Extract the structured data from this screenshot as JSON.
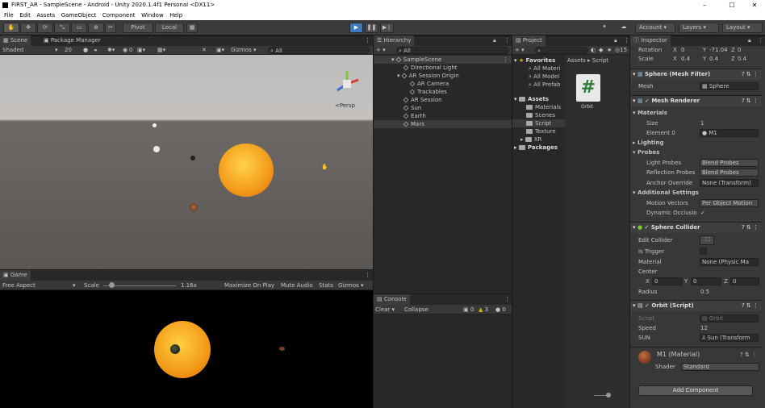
{
  "window": {
    "title": "FIRST_AR - SampleScene - Android - Unity 2020.1.4f1 Personal <DX11>",
    "min": "–",
    "max": "☐",
    "close": "✕"
  },
  "menu": [
    "File",
    "Edit",
    "Assets",
    "GameObject",
    "Component",
    "Window",
    "Help"
  ],
  "toolbar": {
    "pivot": "Pivot",
    "local": "Local",
    "account": "Account",
    "layers": "Layers",
    "layout": "Layout"
  },
  "scene": {
    "tab": "Scene",
    "tab2": "Package Manager",
    "shading": "Shaded",
    "gizmos": "Gizmos",
    "search": "All",
    "persp": "<Persp",
    "fov": "20",
    "layers_count": "0"
  },
  "game": {
    "tab": "Game",
    "aspect": "Free Aspect",
    "scale_label": "Scale",
    "scale_value": "1.16x",
    "maximize": "Maximize On Play",
    "mute": "Mute Audio",
    "stats": "Stats",
    "gizmos": "Gizmos"
  },
  "hierarchy": {
    "tab": "Hierarchy",
    "search": "All",
    "items": [
      {
        "label": "SampleScene",
        "depth": 0
      },
      {
        "label": "Directional Light",
        "depth": 1
      },
      {
        "label": "AR Session Origin",
        "depth": 1
      },
      {
        "label": "AR Camera",
        "depth": 2
      },
      {
        "label": "Trackables",
        "depth": 2
      },
      {
        "label": "AR Session",
        "depth": 1
      },
      {
        "label": "Sun",
        "depth": 1
      },
      {
        "label": "Earth",
        "depth": 1
      },
      {
        "label": "Mars",
        "depth": 1
      }
    ]
  },
  "console": {
    "tab": "Console",
    "clear": "Clear",
    "collapse": "Collapse",
    "logs": "0",
    "warnings": "3",
    "errors": "0"
  },
  "project": {
    "tab": "Project",
    "hidden_count": "15",
    "favorites": "Favorites",
    "fav_items": [
      "All Materi",
      "All Model",
      "All Prefab"
    ],
    "assets": "Assets",
    "asset_items": [
      "Materials",
      "Scenes",
      "Script",
      "Texture",
      "XR"
    ],
    "packages": "Packages",
    "breadcrumb": [
      "Assets",
      "Script"
    ],
    "file": "Orbit"
  },
  "inspector": {
    "tab": "Inspector",
    "rotation": {
      "label": "Rotation",
      "x": "0",
      "y": "-71.04",
      "z": "0"
    },
    "scale": {
      "label": "Scale",
      "x": "0.4",
      "y": "0.4",
      "z": "0.4"
    },
    "mesh_filter": {
      "title": "Sphere (Mesh Filter)",
      "mesh_label": "Mesh",
      "mesh_value": "Sphere"
    },
    "mesh_renderer": {
      "title": "Mesh Renderer",
      "materials": "Materials",
      "size_label": "Size",
      "size_value": "1",
      "element_label": "Element 0",
      "element_value": "M1",
      "lighting": "Lighting",
      "probes": "Probes",
      "light_probes_label": "Light Probes",
      "light_probes_value": "Blend Probes",
      "reflection_label": "Reflection Probes",
      "reflection_value": "Blend Probes",
      "anchor_label": "Anchor Override",
      "anchor_value": "None (Transform)",
      "additional": "Additional Settings",
      "motion_label": "Motion Vectors",
      "motion_value": "Per Object Motion",
      "occlusion_label": "Dynamic Occlusio",
      "occlusion_value": "✓"
    },
    "collider": {
      "title": "Sphere Collider",
      "edit_label": "Edit Collider",
      "trigger_label": "Is Trigger",
      "material_label": "Material",
      "material_value": "None (Physic Ma",
      "center_label": "Center",
      "cx": "0",
      "cy": "0",
      "cz": "0",
      "radius_label": "Radius",
      "radius_value": "0.5"
    },
    "orbit": {
      "title": "Orbit (Script)",
      "script_label": "Script",
      "script_value": "Orbit",
      "speed_label": "Speed",
      "speed_value": "12",
      "sun_label": "SUN",
      "sun_value": "Sun (Transform"
    },
    "material": {
      "title": "M1 (Material)",
      "shader_label": "Shader",
      "shader_value": "Standard"
    },
    "add_component": "Add Component"
  }
}
